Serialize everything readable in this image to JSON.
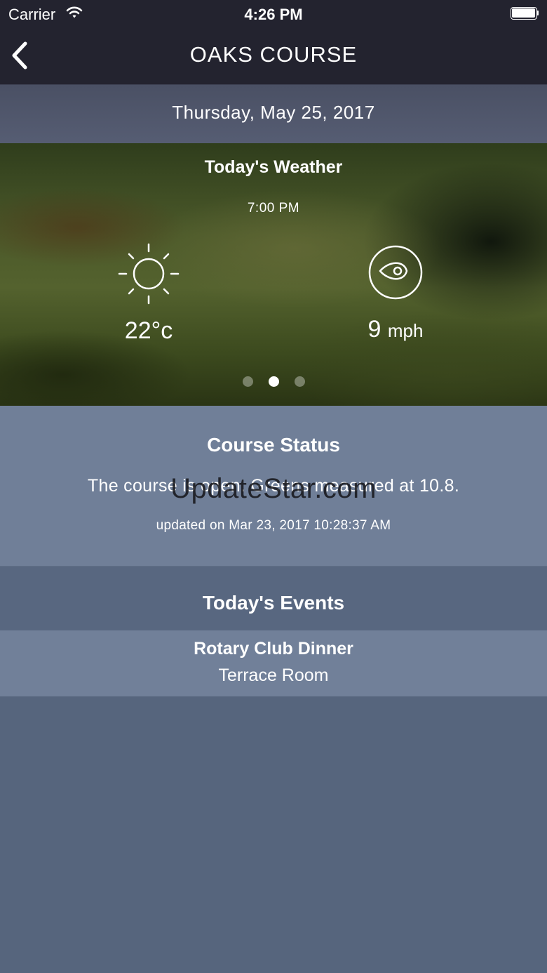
{
  "status_bar": {
    "carrier": "Carrier",
    "time": "4:26 PM",
    "icons": [
      "wifi-icon",
      "battery-icon"
    ]
  },
  "nav": {
    "title": "OAKS COURSE",
    "back_icon": "chevron-left-icon"
  },
  "date": "Thursday, May 25, 2017",
  "weather": {
    "title": "Today's Weather",
    "time": "7:00 PM",
    "temperature": "22°c",
    "temperature_icon": "sun-icon",
    "wind_speed": "9",
    "wind_unit": "mph",
    "wind_icon": "wind-direction-icon",
    "pager": {
      "pages": 3,
      "active_index": 1
    }
  },
  "course_status": {
    "title": "Course Status",
    "text": "The course is open. Greens measured at 10.8.",
    "updated": "updated on Mar 23, 2017 10:28:37 AM"
  },
  "watermark": "UpdateStar.com",
  "events": {
    "title": "Today's Events",
    "items": [
      {
        "name": "Rotary Club Dinner",
        "location": "Terrace Room"
      }
    ]
  },
  "colors": {
    "header_bg": "#23232f",
    "page_bg": "#56657d",
    "status_bg": "#707f98",
    "event_bg": "#718099"
  }
}
